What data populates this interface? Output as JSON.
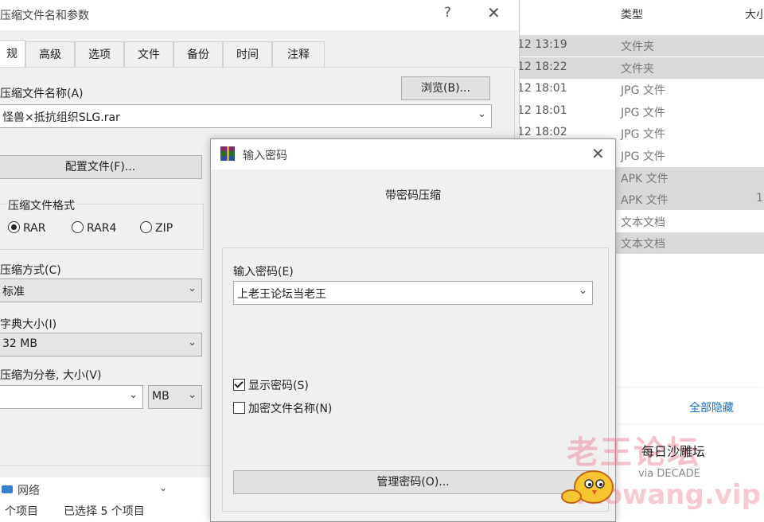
{
  "explorer": {
    "columns": {
      "type": "类型",
      "size": "大小"
    },
    "rows": [
      {
        "date": "12 13:19",
        "type": "文件夹",
        "size": "",
        "selected": true
      },
      {
        "date": "12 18:22",
        "type": "文件夹",
        "size": "",
        "selected": true
      },
      {
        "date": "12 18:01",
        "type": "JPG 文件",
        "size": "",
        "selected": false
      },
      {
        "date": "12 18:01",
        "type": "JPG 文件",
        "size": "",
        "selected": false
      },
      {
        "date": "12 18:02",
        "type": "JPG 文件",
        "size": "",
        "selected": false
      },
      {
        "date": "",
        "type": "JPG 文件",
        "size": "",
        "selected": false
      },
      {
        "date": "",
        "type": "APK 文件",
        "size": "",
        "selected": true
      },
      {
        "date": "",
        "type": "APK 文件",
        "size": "1",
        "selected": true
      },
      {
        "date": "",
        "type": "文本文档",
        "size": "",
        "selected": false
      },
      {
        "date": "",
        "type": "文本文档",
        "size": "",
        "selected": true
      }
    ],
    "nav_network": "网络",
    "status_count": "个项目",
    "status_selected": "已选择 5 个项目"
  },
  "archive_dialog": {
    "title": "压缩文件名和参数",
    "help": "?",
    "close": "✕",
    "tabs": [
      "规",
      "高级",
      "选项",
      "文件",
      "备份",
      "时间",
      "注释"
    ],
    "archive_name_label": "压缩文件名称(A)",
    "browse_button": "浏览(B)...",
    "archive_name_value": "怪兽×抵抗组织SLG.rar",
    "profiles_button": "配置文件(F)...",
    "format_group_label": "压缩文件格式",
    "formats": {
      "rar": "RAR",
      "rar4": "RAR4",
      "zip": "ZIP"
    },
    "selected_format": "RAR",
    "method_label": "压缩方式(C)",
    "method_value": "标准",
    "dict_label": "字典大小(I)",
    "dict_value": "32 MB",
    "volume_label": "压缩为分卷, 大小(V)",
    "volume_value": "",
    "volume_unit": "MB"
  },
  "password_dialog": {
    "title": "输入密码",
    "close": "✕",
    "heading": "带密码压缩",
    "enter_password_label": "输入密码(E)",
    "password_value": "上老王论坛当老王",
    "show_password_label": "显示密码(S)",
    "show_password_checked": true,
    "encrypt_names_label": "加密文件名称(N)",
    "encrypt_names_checked": false,
    "organize_button": "管理密码(O)..."
  },
  "notification": {
    "hide_all": "全部隐藏"
  },
  "watermark": {
    "big_text": "老王论坛",
    "daily_text": "每日沙雕坛",
    "via_text": "via DECADE",
    "domain_text": "laowang.vip"
  },
  "colors": {
    "dialog_bg": "#f0f0f0",
    "selection_grey": "#d9d9d9",
    "link_blue": "#1a6ec2",
    "watermark_pink": "#ec788c"
  },
  "icons": {
    "arrow": "chevron-down-icon",
    "app": "winrar-books-icon",
    "network": "network-icon",
    "mascot": "chick-mascot-icon"
  }
}
